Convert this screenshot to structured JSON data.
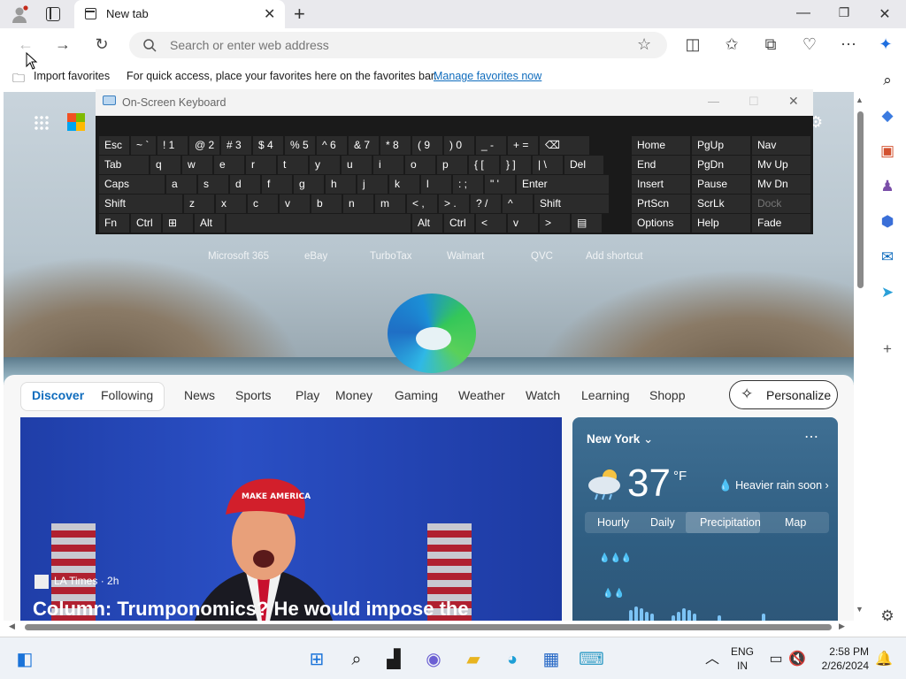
{
  "browser": {
    "tab_title": "New tab",
    "address_placeholder": "Search or enter web address",
    "favbar": {
      "import_label": "Import favorites",
      "message": "For quick access, place your favorites here on the favorites bar.",
      "link": "Manage favorites now"
    }
  },
  "newtab": {
    "shortcuts": [
      "Microsoft 365",
      "eBay",
      "TurboTax",
      "Walmart",
      "QVC",
      "Add shortcut"
    ],
    "feed_tabs": [
      "Discover",
      "Following",
      "News",
      "Sports",
      "Play",
      "Money",
      "Gaming",
      "Weather",
      "Watch",
      "Learning",
      "Shopp"
    ],
    "personalize_label": "Personalize",
    "news": {
      "source": "LA Times · 2h",
      "headline": "Column: Trumponomics? He would impose the"
    },
    "weather": {
      "location": "New York",
      "temp": "37",
      "unit": "°F",
      "condition": "Heavier rain soon",
      "tabs": [
        "Hourly",
        "Daily",
        "Precipitation",
        "Map"
      ],
      "selected_tab": "Precipitation"
    }
  },
  "osk": {
    "title": "On-Screen Keyboard",
    "row1": [
      "Esc",
      "~ `",
      "! 1",
      "@ 2",
      "# 3",
      "$ 4",
      "% 5",
      "^ 6",
      "& 7",
      "* 8",
      "( 9",
      ") 0",
      "_ -",
      "+ =",
      "⌫"
    ],
    "row2": [
      "Tab",
      "q",
      "w",
      "e",
      "r",
      "t",
      "y",
      "u",
      "i",
      "o",
      "p",
      "{ [",
      "} ]",
      "| \\",
      "Del"
    ],
    "row3": [
      "Caps",
      "a",
      "s",
      "d",
      "f",
      "g",
      "h",
      "j",
      "k",
      "l",
      ": ;",
      "\" '",
      "Enter"
    ],
    "row4": [
      "Shift",
      "z",
      "x",
      "c",
      "v",
      "b",
      "n",
      "m",
      "< ,",
      "> .",
      "? /",
      "^",
      "Shift"
    ],
    "row5": [
      "Fn",
      "Ctrl",
      "⊞",
      "Alt",
      "",
      "Alt",
      "Ctrl",
      "<",
      "v",
      ">",
      "▤"
    ],
    "side": [
      [
        "Home",
        "PgUp",
        "Nav"
      ],
      [
        "End",
        "PgDn",
        "Mv Up"
      ],
      [
        "Insert",
        "Pause",
        "Mv Dn"
      ],
      [
        "PrtScn",
        "ScrLk",
        "Dock"
      ],
      [
        "Options",
        "Help",
        "Fade"
      ]
    ]
  },
  "taskbar": {
    "lang1": "ENG",
    "lang2": "IN",
    "time": "2:58 PM",
    "date": "2/26/2024"
  }
}
